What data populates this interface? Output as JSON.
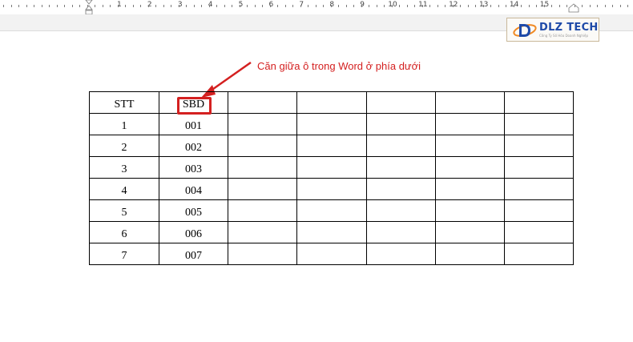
{
  "ruler": {
    "numbers": [
      "1",
      "2",
      "3",
      "4",
      "5",
      "6",
      "7",
      "8",
      "9",
      "10",
      "11",
      "12",
      "13",
      "14",
      "15"
    ]
  },
  "logo": {
    "brand": "DLZ TECH",
    "tagline": "Công Ty Số Hóa Doanh Nghiệp"
  },
  "annotation": {
    "text": "Căn giữa ô trong Word ở phía dưới",
    "color": "#d42020"
  },
  "table": {
    "header": [
      "STT",
      "SBD",
      "",
      "",
      "",
      "",
      ""
    ],
    "rows": [
      [
        "1",
        "001",
        "",
        "",
        "",
        "",
        ""
      ],
      [
        "2",
        "002",
        "",
        "",
        "",
        "",
        ""
      ],
      [
        "3",
        "003",
        "",
        "",
        "",
        "",
        ""
      ],
      [
        "4",
        "004",
        "",
        "",
        "",
        "",
        ""
      ],
      [
        "5",
        "005",
        "",
        "",
        "",
        "",
        ""
      ],
      [
        "6",
        "006",
        "",
        "",
        "",
        "",
        ""
      ],
      [
        "7",
        "007",
        "",
        "",
        "",
        "",
        ""
      ]
    ]
  }
}
